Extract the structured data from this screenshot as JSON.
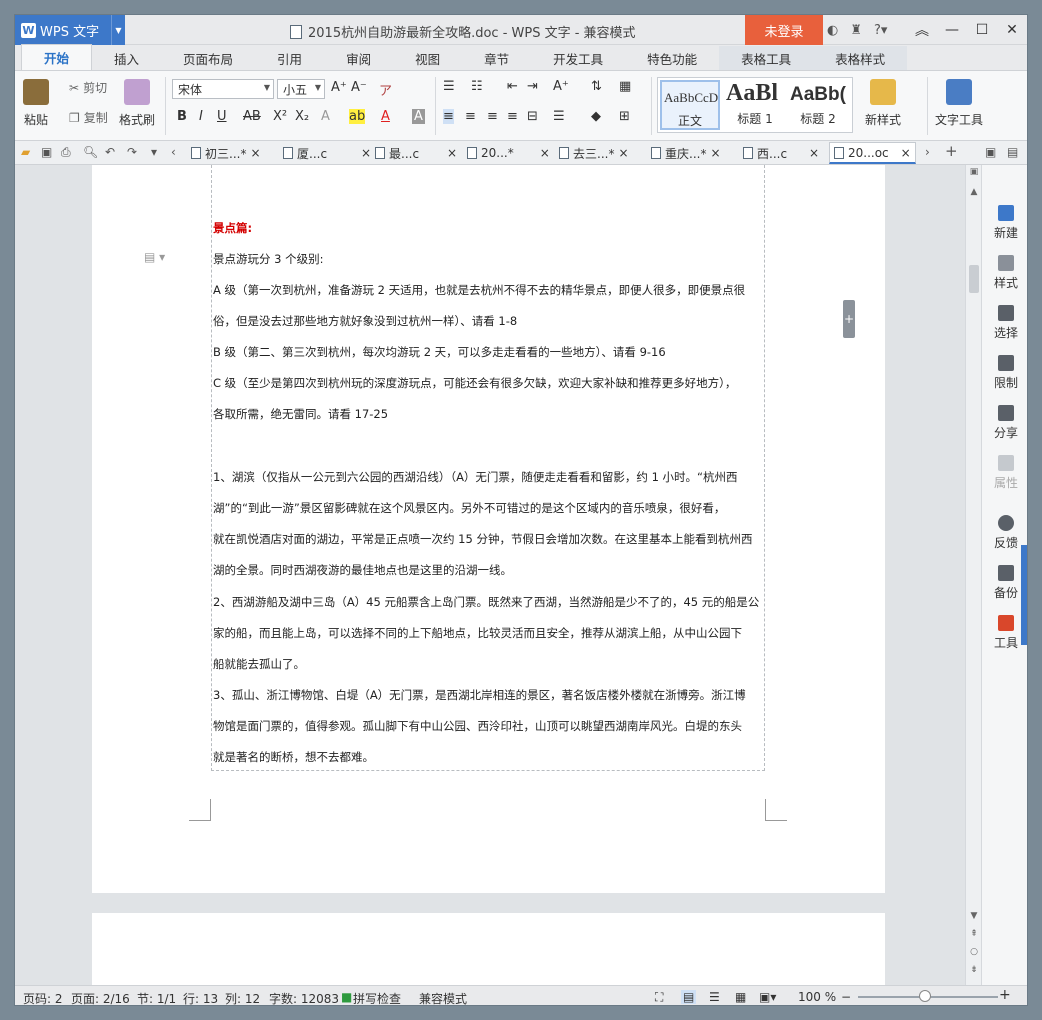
{
  "window": {
    "app_name": "WPS 文字",
    "title": "2015杭州自助游最新全攻略.doc - WPS 文字 - 兼容模式",
    "login_label": "未登录",
    "help_label": "?"
  },
  "ribbon_tabs": [
    "开始",
    "插入",
    "页面布局",
    "引用",
    "审阅",
    "视图",
    "章节",
    "开发工具",
    "特色功能",
    "表格工具",
    "表格样式"
  ],
  "ribbon": {
    "paste": "粘贴",
    "cut": "剪切",
    "copy": "复制",
    "format_painter": "格式刷",
    "font_name": "宋体",
    "font_size": "小五",
    "styles": [
      {
        "preview": "AaBbCcD",
        "name": "正文"
      },
      {
        "preview": "AaBl",
        "name": "标题 1"
      },
      {
        "preview": "AaBb(",
        "name": "标题 2"
      }
    ],
    "new_style": "新样式",
    "text_tools": "文字工具"
  },
  "doc_tabs": [
    "初三...*",
    "厦...c",
    "最...c",
    "20...*",
    "去三...*",
    "重庆...*",
    "西...c",
    "20...oc"
  ],
  "document": {
    "heading": "景点篇:",
    "lines": [
      "景点游玩分 3 个级别:",
      "A 级（第一次到杭州，准备游玩 2 天适用，也就是去杭州不得不去的精华景点，即便人很多，即便景点很",
      "俗，但是没去过那些地方就好象没到过杭州一样）、请看 1-8",
      "B 级（第二、第三次到杭州，每次均游玩 2 天，可以多走走看看的一些地方）、请看 9-16",
      "C 级（至少是第四次到杭州玩的深度游玩点，可能还会有很多欠缺，欢迎大家补缺和推荐更多好地方），",
      "各取所需，绝无雷同。请看 17-25",
      "1、湖滨（仅指从一公元到六公园的西湖沿线）（A）无门票，随便走走看看和留影，约 1 小时。“杭州西",
      "湖”的“到此一游”景区留影碑就在这个风景区内。另外不可错过的是这个区域内的音乐喷泉，很好看，",
      "就在凯悦酒店对面的湖边，平常是正点喷一次约 15 分钟，节假日会增加次数。在这里基本上能看到杭州西",
      "湖的全景。同时西湖夜游的最佳地点也是这里的沿湖一线。",
      "2、西湖游船及湖中三岛（A）45 元船票含上岛门票。既然来了西湖，当然游船是少不了的，45 元的船是公",
      "家的船，而且能上岛，可以选择不同的上下船地点，比较灵活而且安全，推荐从湖滨上船，从中山公园下",
      "船就能去孤山了。",
      "3、孤山、浙江博物馆、白堤（A）无门票，是西湖北岸相连的景区，著名饭店楼外楼就在浙博旁。浙江博",
      "物馆是面门票的，值得参观。孤山脚下有中山公园、西泠印社，山顶可以眺望西湖南岸风光。白堤的东头",
      "就是著名的断桥，想不去都难。"
    ]
  },
  "task_pane": [
    "新建",
    "样式",
    "选择",
    "限制",
    "分享",
    "属性",
    "反馈",
    "备份",
    "工具"
  ],
  "status_bar": {
    "page_no": "页码: 2",
    "pages": "页面: 2/16",
    "section": "节: 1/1",
    "row": "行: 13",
    "col": "列: 12",
    "words": "字数: 12083",
    "spell": "拼写检查",
    "mode": "兼容模式",
    "zoom": "100 %"
  },
  "colors": {
    "accent": "#3d78c9",
    "login": "#e8603c",
    "heading_red": "#d40000"
  }
}
